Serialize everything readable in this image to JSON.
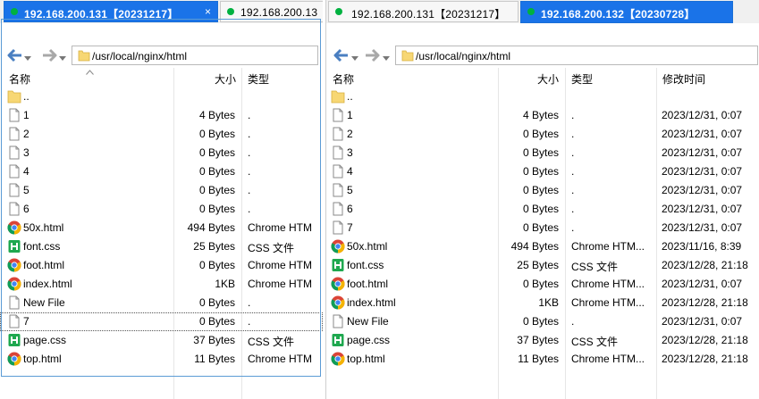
{
  "left": {
    "tabs": [
      {
        "label": "192.168.200.131【20231217】",
        "active": true,
        "close": "×"
      },
      {
        "label": "192.168.200.13",
        "active": false
      }
    ],
    "path": "/usr/local/nginx/html",
    "columns": {
      "name": "名称",
      "size": "大小",
      "type": "类型"
    },
    "files": [
      {
        "name": "..",
        "icon": "folder-icon",
        "size": "",
        "type": ""
      },
      {
        "name": "1",
        "icon": "file-icon",
        "size": "4 Bytes",
        "type": "."
      },
      {
        "name": "2",
        "icon": "file-icon",
        "size": "0 Bytes",
        "type": "."
      },
      {
        "name": "3",
        "icon": "file-icon",
        "size": "0 Bytes",
        "type": "."
      },
      {
        "name": "4",
        "icon": "file-icon",
        "size": "0 Bytes",
        "type": "."
      },
      {
        "name": "5",
        "icon": "file-icon",
        "size": "0 Bytes",
        "type": "."
      },
      {
        "name": "6",
        "icon": "file-icon",
        "size": "0 Bytes",
        "type": "."
      },
      {
        "name": "50x.html",
        "icon": "chrome-icon",
        "size": "494 Bytes",
        "type": "Chrome HTM"
      },
      {
        "name": "font.css",
        "icon": "css-icon",
        "size": "25 Bytes",
        "type": "CSS 文件"
      },
      {
        "name": "foot.html",
        "icon": "chrome-icon",
        "size": "0 Bytes",
        "type": "Chrome HTM"
      },
      {
        "name": "index.html",
        "icon": "chrome-icon",
        "size": "1KB",
        "type": "Chrome HTM"
      },
      {
        "name": "New File",
        "icon": "file-icon",
        "size": "0 Bytes",
        "type": "."
      },
      {
        "name": "7",
        "icon": "file-icon",
        "size": "0 Bytes",
        "type": ".",
        "selected": true
      },
      {
        "name": "page.css",
        "icon": "css-icon",
        "size": "37 Bytes",
        "type": "CSS 文件"
      },
      {
        "name": "top.html",
        "icon": "chrome-icon",
        "size": "11 Bytes",
        "type": "Chrome HTM"
      }
    ]
  },
  "right": {
    "tabs": [
      {
        "label": "192.168.200.131【20231217】",
        "active": false
      },
      {
        "label": "192.168.200.132【20230728】",
        "active": true
      }
    ],
    "path": "/usr/local/nginx/html",
    "columns": {
      "name": "名称",
      "size": "大小",
      "type": "类型",
      "modified": "修改时间"
    },
    "files": [
      {
        "name": "..",
        "icon": "folder-icon",
        "size": "",
        "type": "",
        "modified": ""
      },
      {
        "name": "1",
        "icon": "file-icon",
        "size": "4 Bytes",
        "type": ".",
        "modified": "2023/12/31, 0:07"
      },
      {
        "name": "2",
        "icon": "file-icon",
        "size": "0 Bytes",
        "type": ".",
        "modified": "2023/12/31, 0:07"
      },
      {
        "name": "3",
        "icon": "file-icon",
        "size": "0 Bytes",
        "type": ".",
        "modified": "2023/12/31, 0:07"
      },
      {
        "name": "4",
        "icon": "file-icon",
        "size": "0 Bytes",
        "type": ".",
        "modified": "2023/12/31, 0:07"
      },
      {
        "name": "5",
        "icon": "file-icon",
        "size": "0 Bytes",
        "type": ".",
        "modified": "2023/12/31, 0:07"
      },
      {
        "name": "6",
        "icon": "file-icon",
        "size": "0 Bytes",
        "type": ".",
        "modified": "2023/12/31, 0:07"
      },
      {
        "name": "7",
        "icon": "file-icon",
        "size": "0 Bytes",
        "type": ".",
        "modified": "2023/12/31, 0:07"
      },
      {
        "name": "50x.html",
        "icon": "chrome-icon",
        "size": "494 Bytes",
        "type": "Chrome HTM...",
        "modified": "2023/11/16, 8:39"
      },
      {
        "name": "font.css",
        "icon": "css-icon",
        "size": "25 Bytes",
        "type": "CSS 文件",
        "modified": "2023/12/28, 21:18"
      },
      {
        "name": "foot.html",
        "icon": "chrome-icon",
        "size": "0 Bytes",
        "type": "Chrome HTM...",
        "modified": "2023/12/31, 0:07"
      },
      {
        "name": "index.html",
        "icon": "chrome-icon",
        "size": "1KB",
        "type": "Chrome HTM...",
        "modified": "2023/12/28, 21:18"
      },
      {
        "name": "New File",
        "icon": "file-icon",
        "size": "0 Bytes",
        "type": ".",
        "modified": "2023/12/31, 0:07"
      },
      {
        "name": "page.css",
        "icon": "css-icon",
        "size": "37 Bytes",
        "type": "CSS 文件",
        "modified": "2023/12/28, 21:18"
      },
      {
        "name": "top.html",
        "icon": "chrome-icon",
        "size": "11 Bytes",
        "type": "Chrome HTM...",
        "modified": "2023/12/28, 21:18"
      }
    ]
  },
  "colors": {
    "active_tab": "#1a73e8",
    "status_dot": "#00b140",
    "frame": "#5b9bd5"
  }
}
